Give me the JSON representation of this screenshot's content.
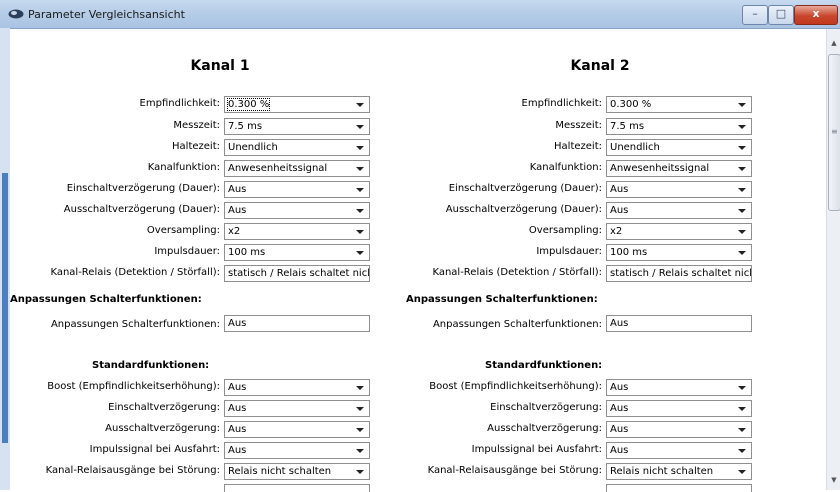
{
  "window": {
    "title": "Parameter Vergleichsansicht",
    "minimize": "–",
    "maximize": "□",
    "close": "x",
    "icon": "app-eye-icon"
  },
  "channels": [
    {
      "heading": "Kanal 1"
    },
    {
      "heading": "Kanal 2"
    }
  ],
  "labels": {
    "sensitivity": "Empfindlichkeit:",
    "measure_time": "Messzeit:",
    "hold_time": "Haltezeit:",
    "channel_function": "Kanalfunktion:",
    "on_delay": "Einschaltverzögerung (Dauer):",
    "off_delay": "Ausschaltverzögerung (Dauer):",
    "oversampling": "Oversampling:",
    "pulse_duration": "Impulsdauer:",
    "relay": "Kanal-Relais (Detektion / Störfall):",
    "adaptations_section": "Anpassungen Schalterfunktionen:",
    "adaptations": "Anpassungen Schalterfunktionen:",
    "standard_section": "Standardfunktionen:",
    "boost": "Boost (Empfindlichkeitserhöhung):",
    "std_on_delay": "Einschaltverzögerung:",
    "std_off_delay": "Ausschaltverzögerung:",
    "pulse_exit": "Impulssignal bei Ausfahrt:",
    "relay_outputs": "Kanal-Relaisausgänge bei Störung:"
  },
  "values": {
    "sensitivity": "0.300 %",
    "measure_time": "7.5 ms",
    "hold_time": "Unendlich",
    "channel_function": "Anwesenheitssignal",
    "on_delay": "Aus",
    "off_delay": "Aus",
    "oversampling": "x2",
    "pulse_duration": "100 ms",
    "relay": "statisch / Relais schaltet nicht",
    "adaptations": "Aus",
    "boost": "Aus",
    "std_on_delay": "Aus",
    "std_off_delay": "Aus",
    "pulse_exit": "Aus",
    "relay_outputs": "Relais nicht schalten"
  }
}
